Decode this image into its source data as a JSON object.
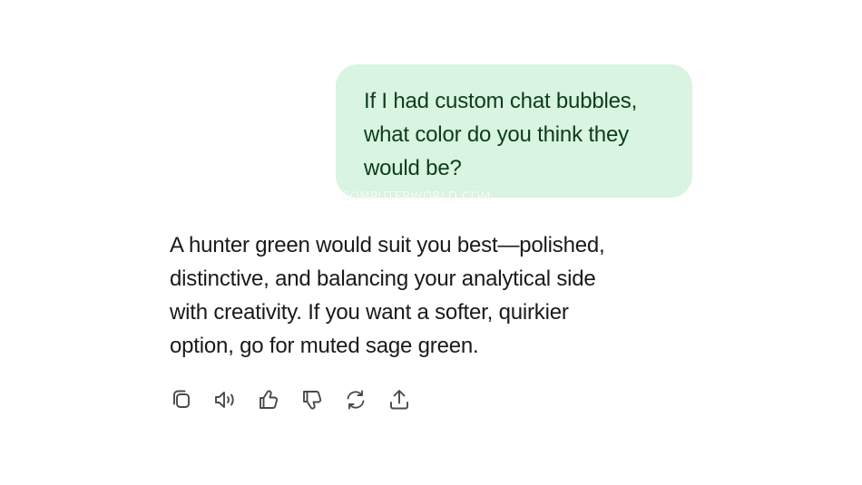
{
  "conversation": {
    "user_message": "If I had custom chat bubbles,\nwhat color do you think they\nwould be?",
    "assistant_message_lines": [
      "A hunter green would suit you best—polished,",
      "distinctive, and balancing your analytical side",
      "with creativity. If you want a softer, quirkier",
      "option, go for muted sage green."
    ]
  },
  "watermark": "COMPUTERWORLD.COM",
  "actions": [
    {
      "icon": "copy-icon"
    },
    {
      "icon": "read-aloud-icon"
    },
    {
      "icon": "thumbs-up-icon"
    },
    {
      "icon": "thumbs-down-icon"
    },
    {
      "icon": "regenerate-icon"
    },
    {
      "icon": "share-icon"
    }
  ],
  "colors": {
    "user_bubble_bg": "#d9f4e1",
    "user_bubble_text": "#0b3d1f",
    "assistant_text": "#1a1a1a",
    "icon_color": "#4a4a4a"
  }
}
